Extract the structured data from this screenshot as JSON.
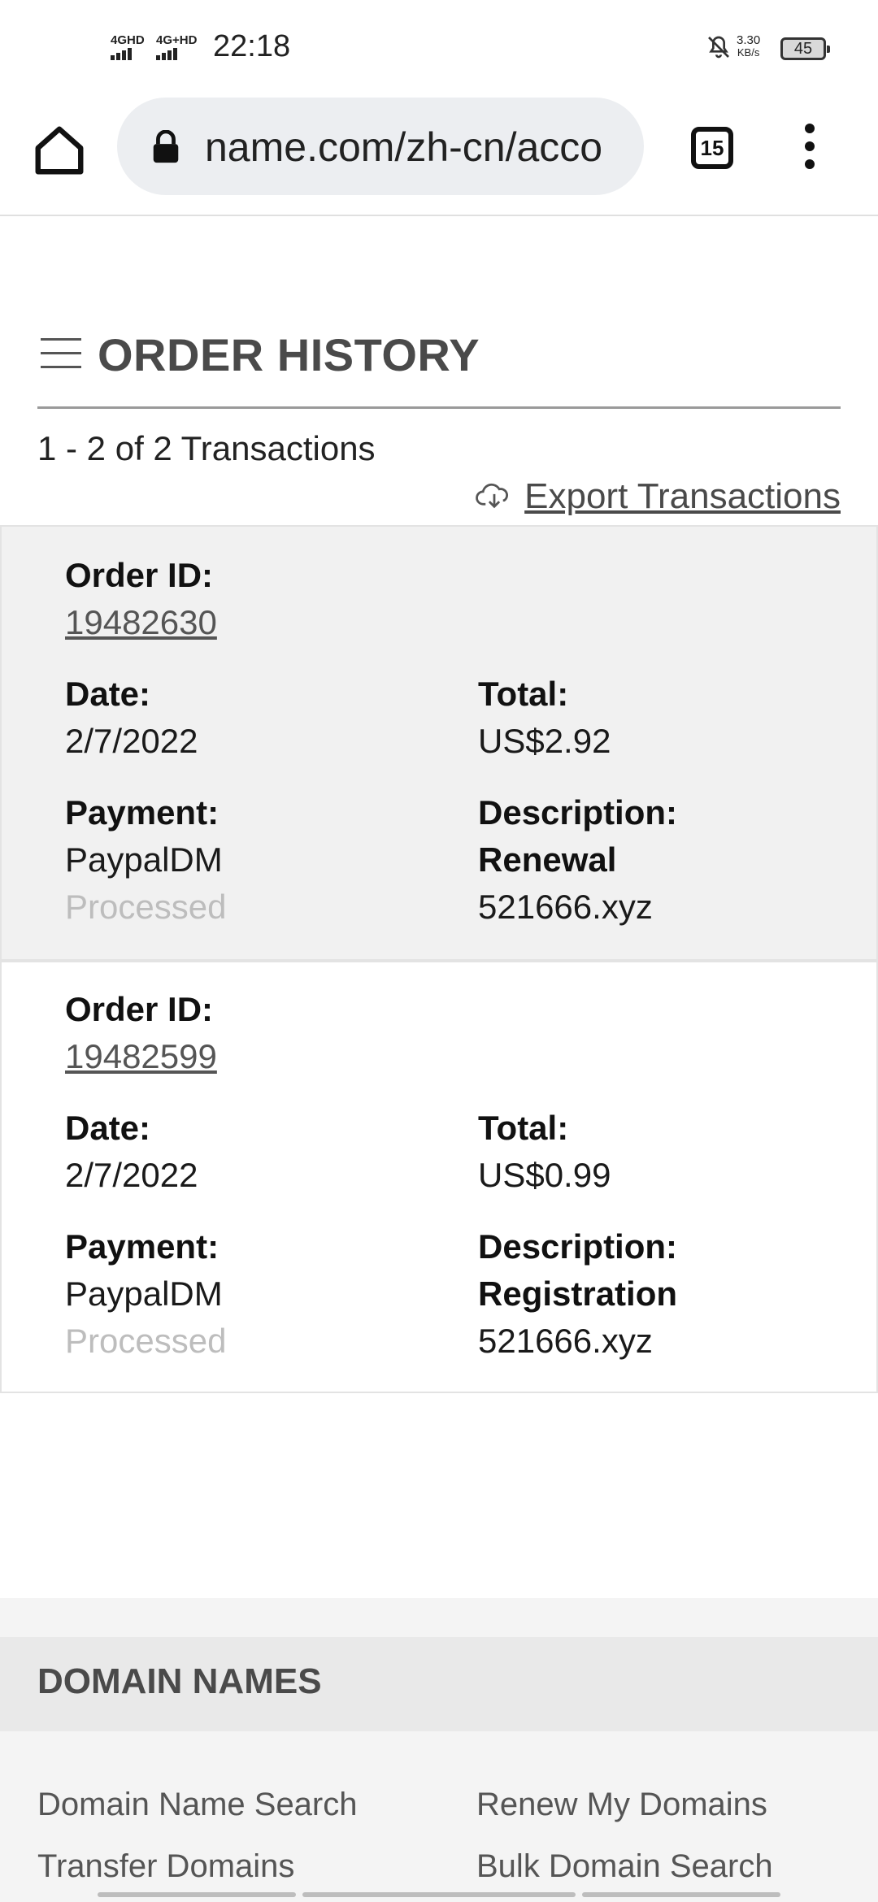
{
  "status_bar": {
    "network1": "4GHD",
    "network2": "4G+HD",
    "time": "22:18",
    "speed_value": "3.30",
    "speed_unit": "KB/s",
    "battery": "45"
  },
  "browser": {
    "url": "name.com/zh-cn/acco",
    "tab_count": "15"
  },
  "page": {
    "title": "ORDER HISTORY",
    "transactions_count": "1 - 2 of 2 Transactions",
    "export_label": "Export Transactions"
  },
  "orders": [
    {
      "order_id_label": "Order ID:",
      "order_id": "19482630",
      "date_label": "Date:",
      "date": "2/7/2022",
      "total_label": "Total:",
      "total": "US$2.92",
      "payment_label": "Payment:",
      "payment": "PaypalDM",
      "status": "Processed",
      "description_label": "Description:",
      "description_type": "Renewal",
      "description_domain": "521666.xyz"
    },
    {
      "order_id_label": "Order ID:",
      "order_id": "19482599",
      "date_label": "Date:",
      "date": "2/7/2022",
      "total_label": "Total:",
      "total": "US$0.99",
      "payment_label": "Payment:",
      "payment": "PaypalDM",
      "status": "Processed",
      "description_label": "Description:",
      "description_type": "Registration",
      "description_domain": "521666.xyz"
    }
  ],
  "footer": {
    "title": "DOMAIN NAMES",
    "links": [
      "Domain Name Search",
      "Renew My Domains",
      "Transfer Domains",
      "Bulk Domain Search"
    ]
  },
  "icons": [
    "home-icon",
    "lock-icon",
    "tabs-icon",
    "more-vert-icon",
    "menu-icon",
    "cloud-download-icon",
    "bell-off-icon"
  ],
  "colors": {
    "card_shaded": "#f1f1f1",
    "muted_status": "#bdbdbd",
    "title": "#4a4a4a"
  }
}
